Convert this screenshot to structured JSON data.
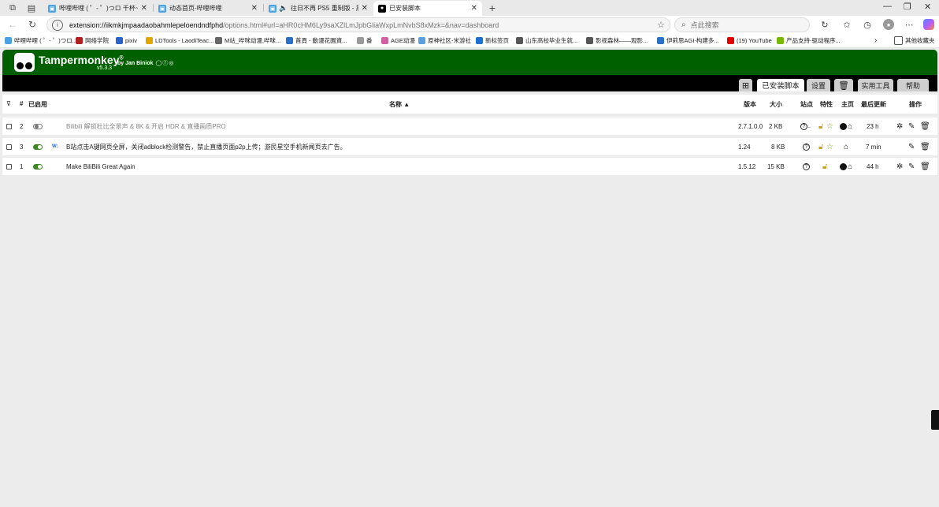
{
  "browser": {
    "tabs": [
      {
        "title": "哔哩哔哩 ( ゜- ゜)つロ 千杯~-bilib",
        "active": false
      },
      {
        "title": "动态首页-哔哩哔哩",
        "active": false
      },
      {
        "title": "往日不再 PS5 重制版 - 黑桐",
        "active": false
      },
      {
        "title": "已安装脚本",
        "active": true
      }
    ],
    "new_tab": "+",
    "url_host": "extension://iikmkjmpaadaobahmlepeloendndfphd",
    "url_rest": "/options.html#url=aHR0cHM6Ly9saXZlLmJpbGliaWxpLmNvbS8xMzk=&nav=dashboard",
    "search_placeholder": "点此搜索",
    "bookmarks": [
      {
        "label": "哔哩哔哩 ( ゜- ゜)つロ...",
        "color": "#4aa3e0"
      },
      {
        "label": "网络学院",
        "color": "#b02020"
      },
      {
        "label": "pixiv",
        "color": "#2a62c8"
      },
      {
        "label": "LDTools - LaodiTeac...",
        "color": "#e0a800"
      },
      {
        "label": "M站_哔咪动漫,哔咪...",
        "color": "#666"
      },
      {
        "label": "首頁 - 動漫花園資...",
        "color": "#2a70c8"
      },
      {
        "label": "番",
        "color": "#999"
      },
      {
        "label": "AGE动漫",
        "color": "#d060a0"
      },
      {
        "label": "原神社区-米游社",
        "color": "#5aa0e0"
      },
      {
        "label": "新标签页",
        "color": "#1e6fd0"
      },
      {
        "label": "山东高校毕业生就...",
        "color": "#555"
      },
      {
        "label": "影视森林——观影...",
        "color": "#555"
      },
      {
        "label": "伊莉思AGI-构建多...",
        "color": "#2a70c8"
      },
      {
        "label": "(19) YouTube",
        "color": "#e00000"
      },
      {
        "label": "产品支持-驱动程序...",
        "color": "#76b900"
      }
    ],
    "bookmarks_more": "其他收藏夹"
  },
  "tm": {
    "title": "Tampermonkey",
    "reg": "®",
    "by": "by Jan Biniok",
    "social": "◯ⓕ◎",
    "version": "v5.3.3",
    "nav_tabs": [
      "已安装脚本",
      "设置",
      "实用工具",
      "帮助"
    ],
    "headers": {
      "num": "#",
      "enabled": "已启用",
      "name": "名称 ▲",
      "version": "版本",
      "size": "大小",
      "sites": "站点",
      "features": "特性",
      "home": "主页",
      "updated": "最后更新",
      "actions": "操作"
    },
    "scripts": [
      {
        "num": "2",
        "enabled": false,
        "name": "Bilibili 解锁杜比全景声 & 8K & 开启 HDR & 直播画质PRO",
        "version": "2.7.1.0.0",
        "size": "2 KB",
        "updated": "23 h",
        "badge": ""
      },
      {
        "num": "3",
        "enabled": true,
        "name": "B站点击A键网页全屏，关闭adblock检测警告，禁止直播页面p2p上传；游民星空手机新闻页去广告。",
        "version": "1.24",
        "size": "8 KB",
        "updated": "7 min",
        "badge": "W:"
      },
      {
        "num": "1",
        "enabled": true,
        "name": "Make BiliBili Great Again",
        "version": "1.5.12",
        "size": "15 KB",
        "updated": "44 h",
        "badge": ""
      }
    ]
  }
}
